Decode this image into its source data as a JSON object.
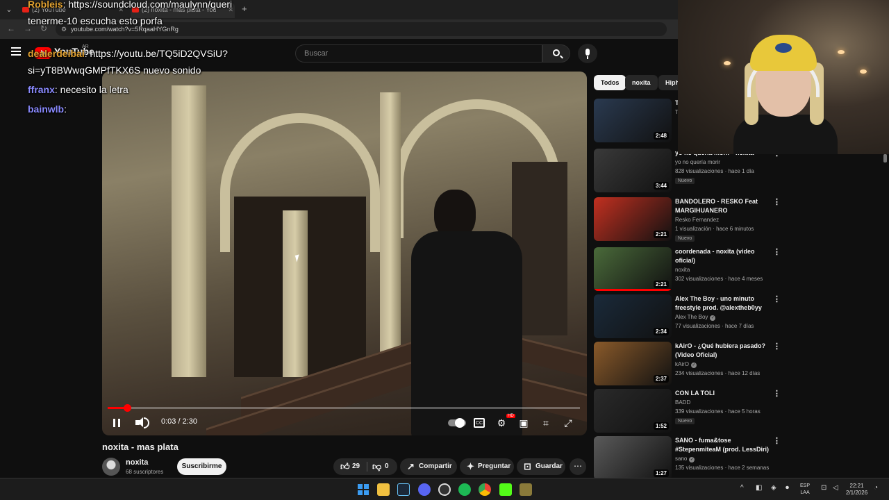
{
  "browser": {
    "tabs": [
      {
        "label": "(2) YouTube"
      },
      {
        "label": "(2) noxita - mas plata - You"
      }
    ],
    "url": "youtube.com/watch?v=5RqaaHYGnRg"
  },
  "youtube": {
    "logo_text": "YouTube",
    "country_code": "AR",
    "search_placeholder": "Buscar"
  },
  "chat": [
    {
      "user": "Robleis",
      "user_color": "#e0a030",
      "message": ": https://soundcloud.com/maulynn/queri"
    },
    {
      "user": "",
      "user_color": "#ffffff",
      "message": "tenerme-10 escucha esto porfa"
    },
    {
      "user": "dealerdeibai",
      "user_color": "#e0a030",
      "message": ": https://youtu.be/TQ5iD2QVSiU?"
    },
    {
      "user": "",
      "user_color": "#ffffff",
      "message": "si=yT8BWwqGMPfTKX6S nuevo sonido"
    },
    {
      "user": "ffranx",
      "user_color": "#8a8aff",
      "message": ": necesito la letra"
    },
    {
      "user": "bainwlb",
      "user_color": "#8a8aff",
      "message": ":"
    }
  ],
  "video": {
    "current_time": "0:03",
    "duration": "2:30",
    "time_display": "0:03 / 2:30",
    "progress": 0.02,
    "title": "noxita - mas plata",
    "channel": "noxita",
    "subscribers": "68 suscriptores",
    "subscribe_label": "Suscribirme",
    "likes": "29",
    "dislikes": "0",
    "share_label": "Compartir",
    "ask_label": "Preguntar",
    "save_label": "Guardar"
  },
  "chips": [
    "Todos",
    "noxita",
    "Hiph"
  ],
  "recommendations": [
    {
      "title": "T... @...",
      "channel": "T...",
      "meta": "",
      "duration": "2:48",
      "badge": "",
      "verified": false,
      "thumb": "#2a3a50"
    },
    {
      "title": "yo no quería morir - noxita",
      "channel": "yo no quería morir",
      "meta": "828 visualizaciones · hace 1 día",
      "duration": "3:44",
      "badge": "Nuevo",
      "verified": false,
      "thumb": "#3a3a3a"
    },
    {
      "title": "BANDOLERO - RESKO Feat MARGIHUANERO",
      "channel": "Resko Fernandez",
      "meta": "1 visualización · hace 6 minutos",
      "duration": "2:21",
      "badge": "Nuevo",
      "verified": false,
      "thumb": "#c23020"
    },
    {
      "title": "coordenada - noxita (video oficial)",
      "channel": "noxita",
      "meta": "302 visualizaciones · hace 4 meses",
      "duration": "2:21",
      "badge": "",
      "verified": false,
      "thumb": "#4a6a3a"
    },
    {
      "title": "Alex The Boy - uno minuto freestyle prod. @alextheb0yy",
      "channel": "Alex The Boy",
      "meta": "77 visualizaciones · hace 7 días",
      "duration": "2:34",
      "badge": "",
      "verified": true,
      "thumb": "#1a2a3a"
    },
    {
      "title": "kAirO - ¿Qué hubiera pasado? (Video Oficial)",
      "channel": "kAirO",
      "meta": "234 visualizaciones · hace 12 días",
      "duration": "2:37",
      "badge": "",
      "verified": true,
      "thumb": "#8a5a2a"
    },
    {
      "title": "CON LA TOLI",
      "channel": "BADD",
      "meta": "339 visualizaciones · hace 5 horas",
      "duration": "1:52",
      "badge": "Nuevo",
      "verified": false,
      "thumb": "#2a2a2a"
    },
    {
      "title": "SANO - fuma&tose #StepenmiteaM (prod. LessDiri)",
      "channel": "sano",
      "meta": "135 visualizaciones · hace 2 semanas",
      "duration": "1:27",
      "badge": "",
      "verified": true,
      "thumb": "#5a5a5a"
    }
  ],
  "taskbar": {
    "lang_top": "ESP",
    "lang_bottom": "LAA",
    "time": "22:21",
    "date": "2/1/2026"
  },
  "colors": {
    "accent": "#ff0000",
    "background": "#0f0f0f"
  }
}
